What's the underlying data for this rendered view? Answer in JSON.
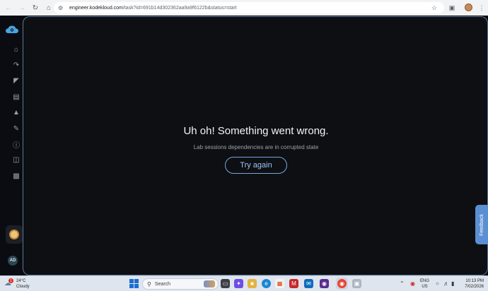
{
  "browser": {
    "url_host": "engineer.kodekloud.com",
    "url_path": "/task?id=691b14d302362aa9a9f6122b&status=start"
  },
  "main": {
    "error_title": "Uh oh! Something went wrong.",
    "error_subtitle": "Lab sessions dependencies are in corrupted state",
    "try_again_label": "Try again"
  },
  "feedback": {
    "label": "Feedback"
  },
  "sidebar": {
    "user_initials": "AD",
    "items": [
      "home-icon",
      "route-icon",
      "chart-icon",
      "video-icon",
      "leaderboard-icon",
      "message-icon",
      "info-icon",
      "book-icon",
      "chat-icon"
    ]
  },
  "taskbar": {
    "weather_temp": "24°C",
    "weather_desc": "Cloudy",
    "weather_badge": "1",
    "search_label": "Search",
    "lang_line1": "ENG",
    "lang_line2": "US",
    "time": "10:13 PM",
    "date": "7/02/2026"
  },
  "colors": {
    "accent": "#78a6dc",
    "feedback": "#5b8fd3",
    "background": "#0e0f13"
  }
}
